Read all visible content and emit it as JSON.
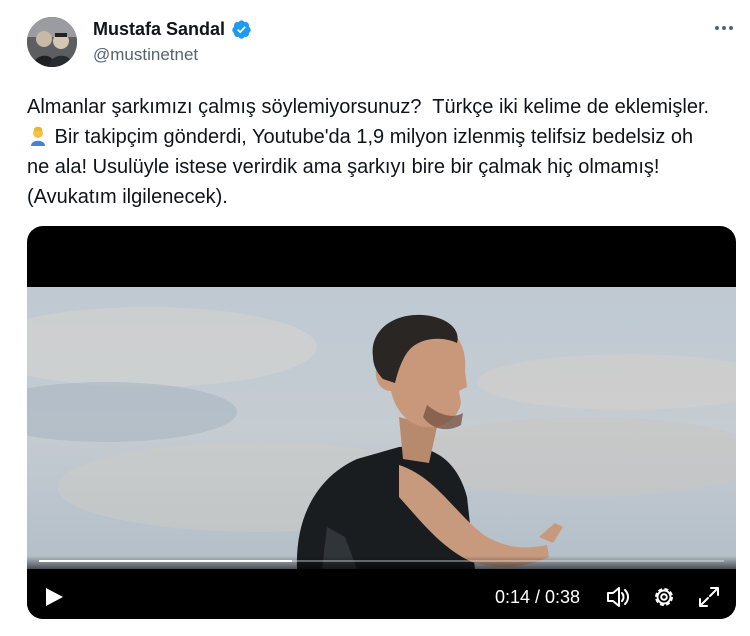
{
  "author": {
    "display_name": "Mustafa Sandal",
    "handle": "@mustinetnet",
    "verified_color": "#1d9bf0"
  },
  "tweet": {
    "text_part1": "Almanlar şarkımızı çalmış söylemiyorsunuz?  Türkçe iki kelime de eklemişler. ",
    "emoji": "man-facepalming-emoji",
    "text_part2": " Bir takipçim gönderdi, Youtube'da 1,9 milyon izlenmiş telifsiz bedelsiz oh ne ala! Usulüyle istese verirdik ama şarkıyı bire bir çalmak hiç olmamış! (Avukatım ilgilenecek)."
  },
  "video": {
    "current_time": "0:14",
    "duration": "0:38",
    "time_display": "0:14 / 0:38",
    "progress": 0.37,
    "icons": [
      "play-icon",
      "volume-icon",
      "settings-icon",
      "fullscreen-icon"
    ]
  },
  "colors": {
    "text_primary": "#0f1419",
    "text_secondary": "#536471",
    "accent": "#1d9bf0"
  }
}
